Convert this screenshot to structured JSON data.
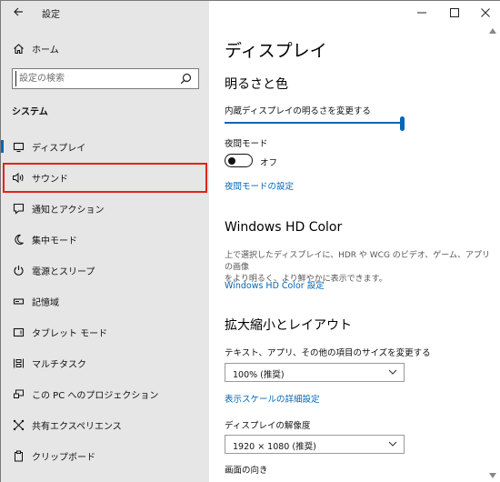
{
  "window": {
    "title": "設定"
  },
  "window_controls": {
    "minimize": "—",
    "maximize": "☐",
    "close": "✕"
  },
  "sidebar": {
    "home_label": "ホーム",
    "search_placeholder": "設定の検索",
    "section": "システム",
    "items": [
      {
        "label": "ディスプレイ",
        "icon": "monitor-icon"
      },
      {
        "label": "サウンド",
        "icon": "speaker-icon"
      },
      {
        "label": "通知とアクション",
        "icon": "notification-icon"
      },
      {
        "label": "集中モード",
        "icon": "moon-icon"
      },
      {
        "label": "電源とスリープ",
        "icon": "power-icon"
      },
      {
        "label": "記憶域",
        "icon": "storage-icon"
      },
      {
        "label": "タブレット モード",
        "icon": "tablet-icon"
      },
      {
        "label": "マルチタスク",
        "icon": "multitask-icon"
      },
      {
        "label": "この PC へのプロジェクション",
        "icon": "projection-icon"
      },
      {
        "label": "共有エクスペリエンス",
        "icon": "share-icon"
      },
      {
        "label": "クリップボード",
        "icon": "clipboard-icon"
      }
    ]
  },
  "main": {
    "title": "ディスプレイ",
    "brightness": {
      "heading": "明るさと色",
      "slider_label": "内蔵ディスプレイの明るさを変更する",
      "slider_value": 1.0
    },
    "night_mode": {
      "label": "夜間モード",
      "state": "オフ",
      "settings_link": "夜間モードの設定"
    },
    "hd_color": {
      "heading": "Windows HD Color",
      "desc_line1": "上で選択したディスプレイに、HDR や WCG のビデオ、ゲーム、アプリの画像",
      "desc_line2": "をより明るく、より鮮やかに表示できます。",
      "link": "Windows HD Color 設定"
    },
    "scale_layout": {
      "heading": "拡大縮小とレイアウト",
      "size_label": "テキスト、アプリ、その他の項目のサイズを変更する",
      "size_value": "100% (推奨)",
      "advanced_link": "表示スケールの詳細設定",
      "resolution_label": "ディスプレイの解像度",
      "resolution_value": "1920 × 1080 (推奨)",
      "orientation_label": "画面の向き"
    }
  },
  "colors": {
    "accent": "#0067b8",
    "highlight": "#e2231a",
    "sidebar_bg": "#e6e6e6"
  }
}
